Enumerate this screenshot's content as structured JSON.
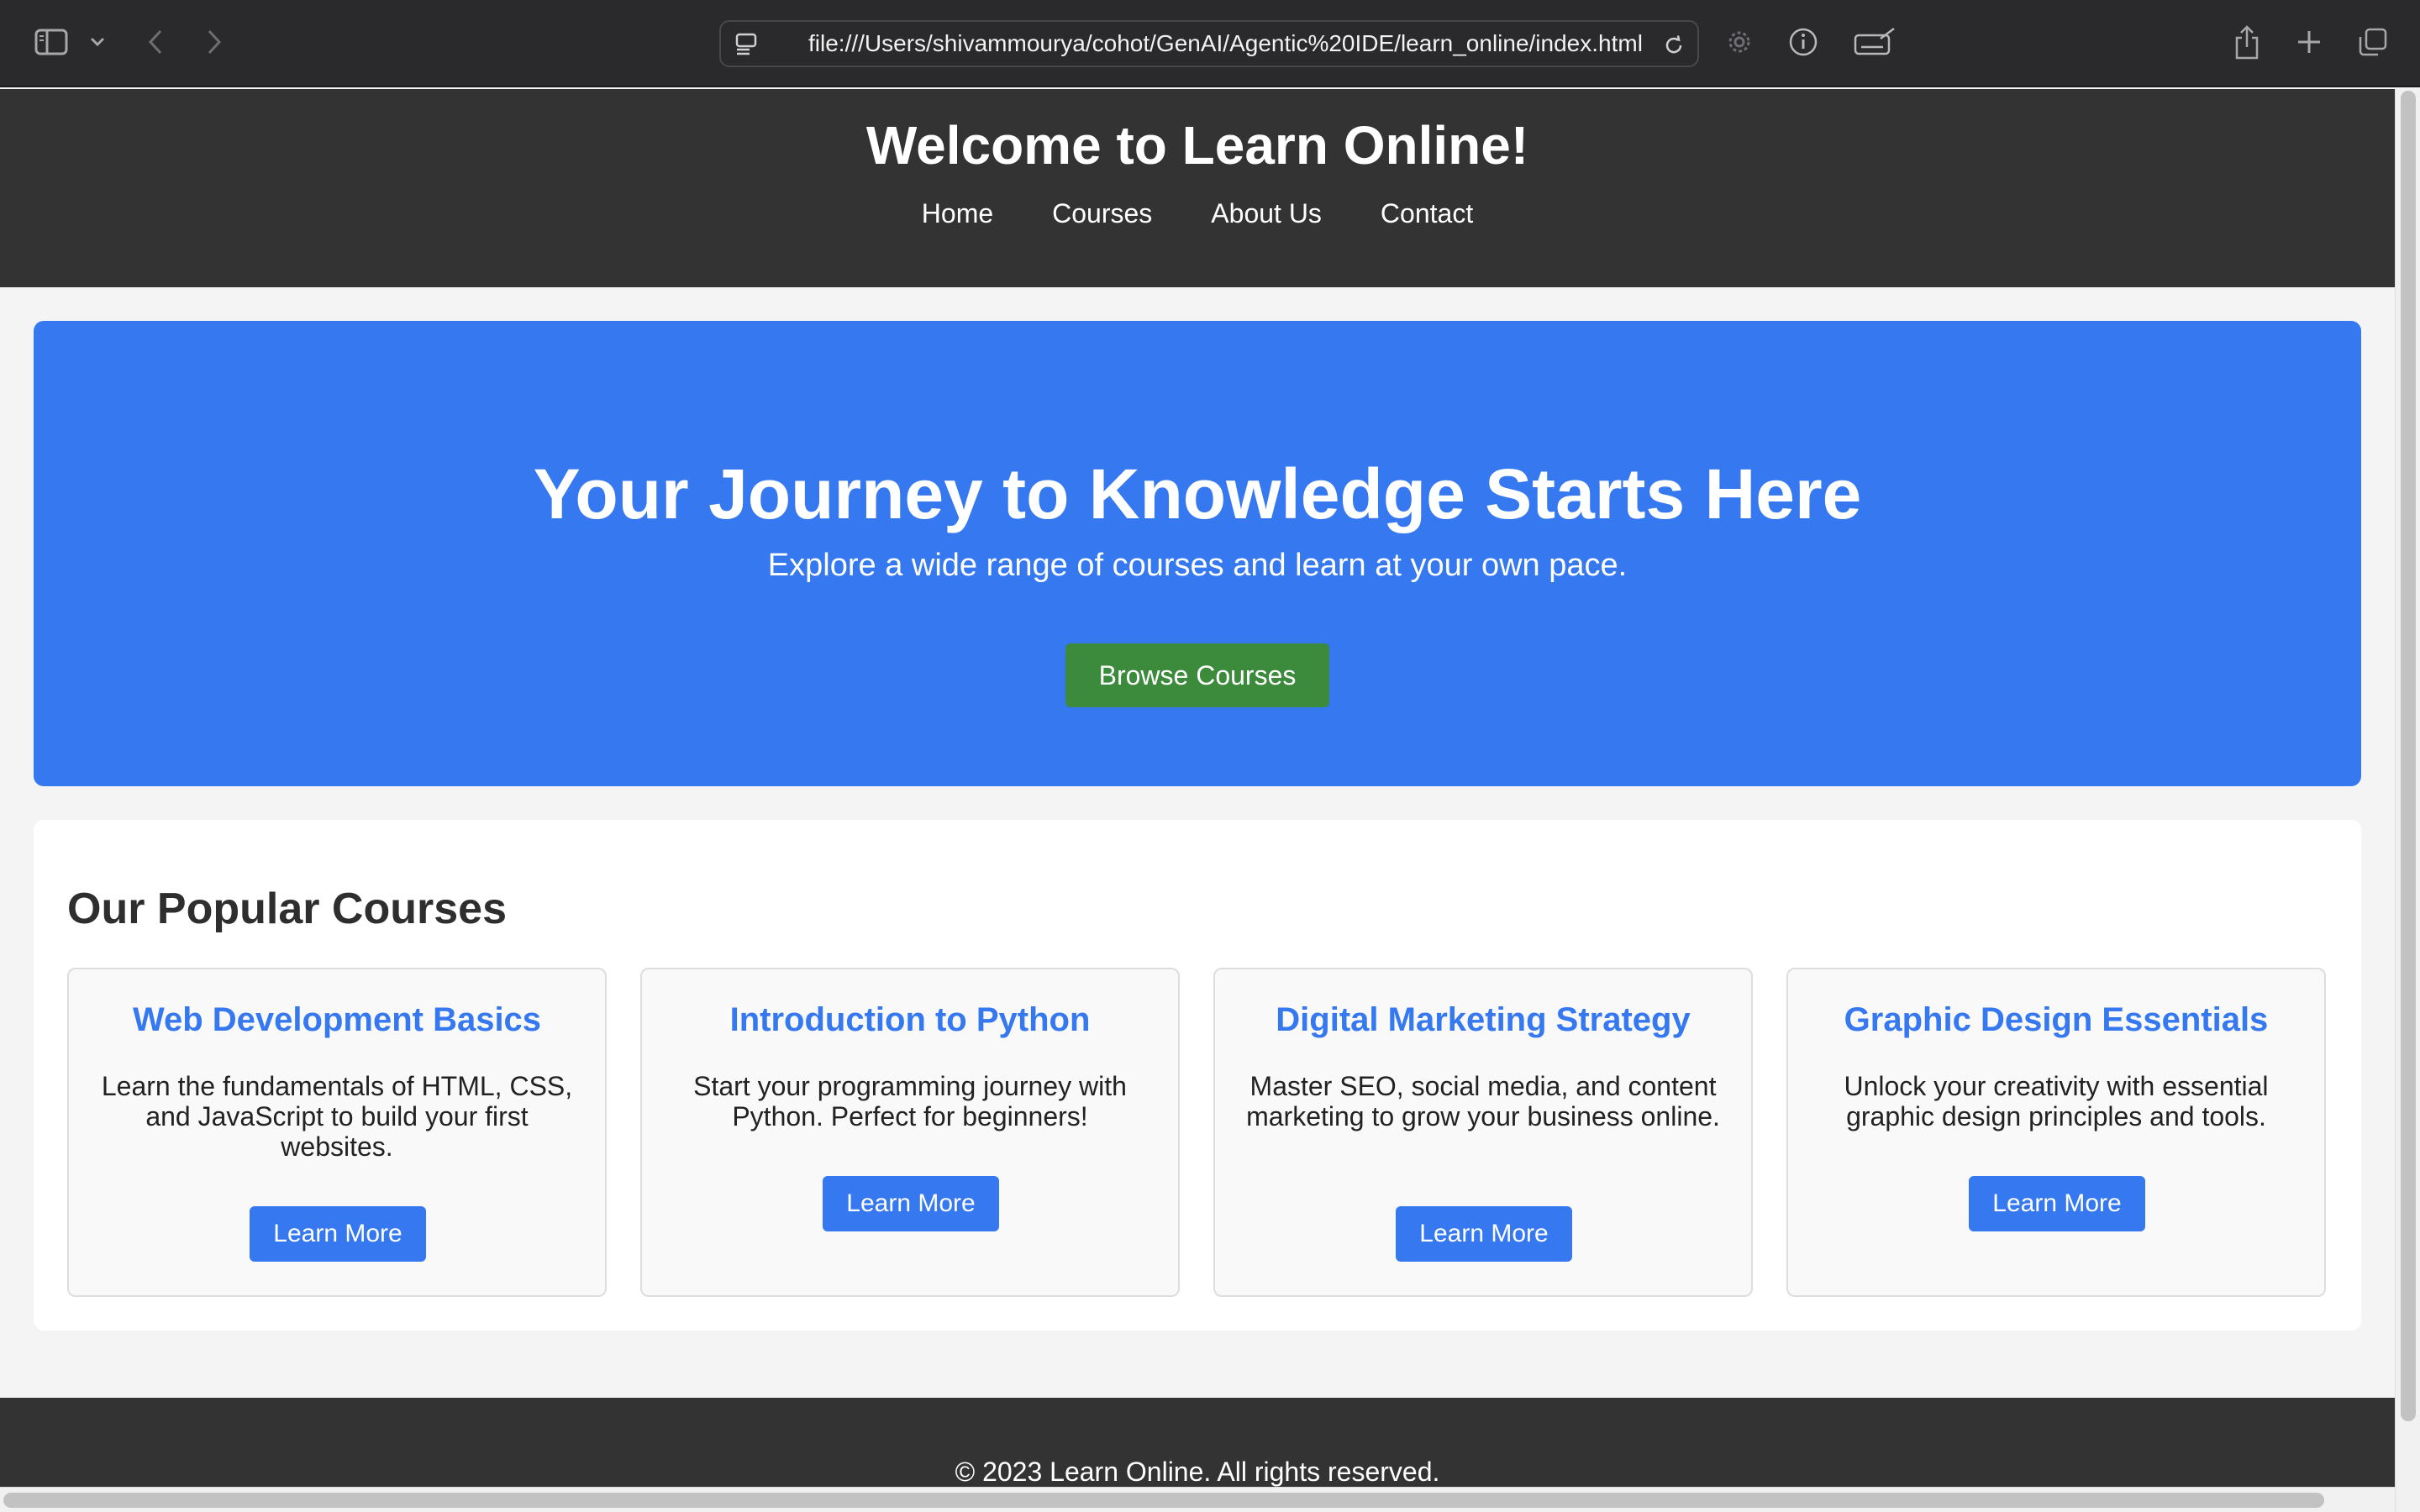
{
  "browser": {
    "url": "file:///Users/shivammourya/cohot/GenAI/Agentic%20IDE/learn_online/index.html",
    "icons": [
      "sidebar-icon",
      "chevron-down-icon",
      "back-icon",
      "forward-icon",
      "page-menu-icon",
      "reload-icon",
      "gear-icon",
      "info-icon",
      "keyboard-icon",
      "share-icon",
      "plus-icon",
      "tabs-icon"
    ]
  },
  "header": {
    "title": "Welcome to Learn Online!",
    "nav": [
      "Home",
      "Courses",
      "About Us",
      "Contact"
    ]
  },
  "hero": {
    "heading": "Your Journey to Knowledge Starts Here",
    "subheading": "Explore a wide range of courses and learn at your own pace.",
    "button": "Browse Courses"
  },
  "courses": {
    "heading": "Our Popular Courses",
    "items": [
      {
        "title": "Web Development Basics",
        "description": "Learn the fundamentals of HTML, CSS, and JavaScript to build your first websites.",
        "button": "Learn More"
      },
      {
        "title": "Introduction to Python",
        "description": "Start your programming journey with Python. Perfect for beginners!",
        "button": "Learn More"
      },
      {
        "title": "Digital Marketing Strategy",
        "description": "Master SEO, social media, and content marketing to grow your business online.",
        "button": "Learn More"
      },
      {
        "title": "Graphic Design Essentials",
        "description": "Unlock your creativity with essential graphic design principles and tools.",
        "button": "Learn More"
      }
    ]
  },
  "footer": {
    "text": "© 2023 Learn Online. All rights reserved."
  },
  "colors": {
    "header_bg": "#333333",
    "hero_bg": "#3578f0",
    "accent": "#3578f0",
    "browse_button": "#3c8a3c",
    "page_bg": "#f4f4f4"
  }
}
